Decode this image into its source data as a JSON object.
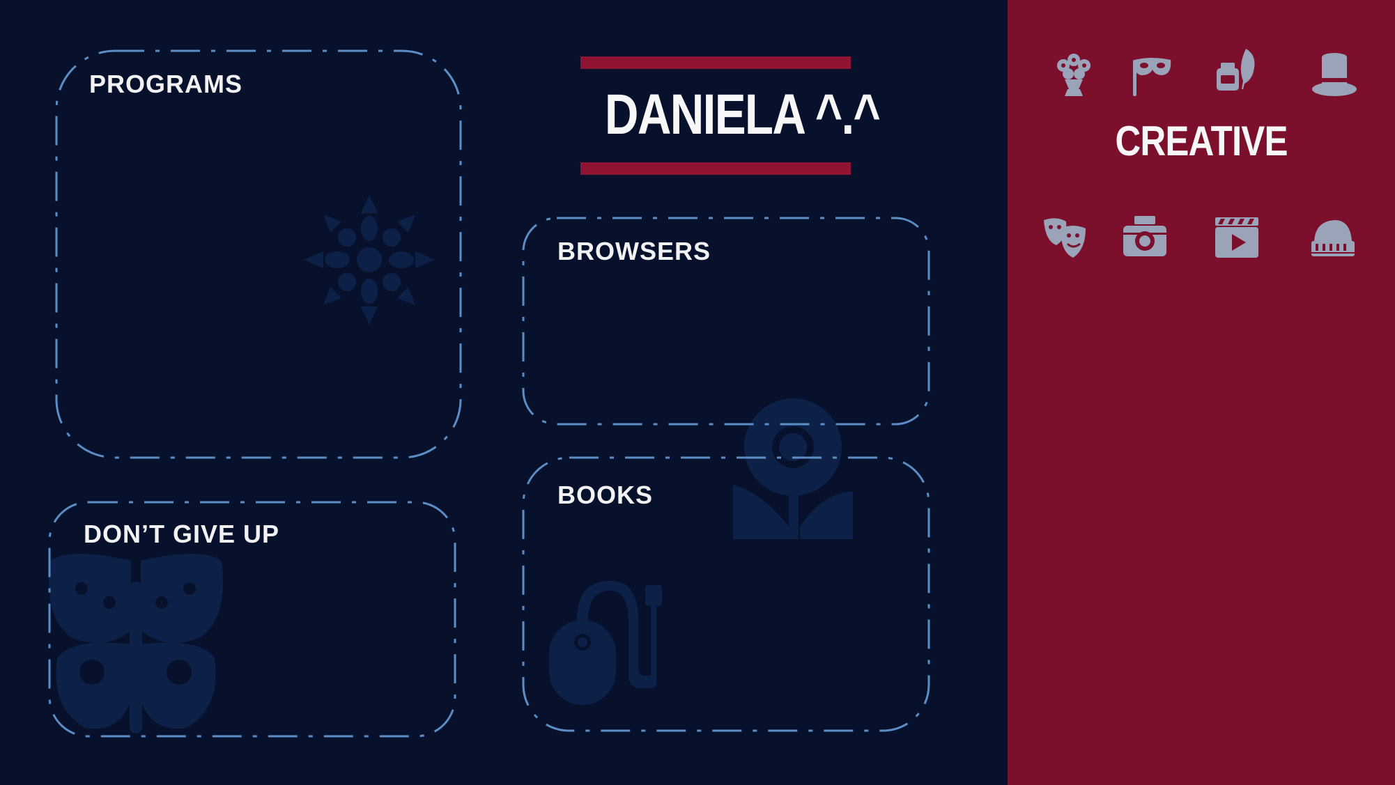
{
  "title": "DANIELA ^.^",
  "panels": {
    "programs": "PROGRAMS",
    "browsers": "BROWSERS",
    "books": "BOOKS",
    "dont_give_up": "DON’T GIVE UP"
  },
  "sidebar": {
    "title": "CREATIVE",
    "icons": [
      "flower-bouquet-icon",
      "carnival-mask-icon",
      "ink-quill-icon",
      "top-hat-icon",
      "theater-masks-icon",
      "camera-icon",
      "video-player-icon",
      "piano-icon"
    ]
  },
  "background_icons": [
    "snowflake-icon",
    "sunflower-icon",
    "butterfly-icon",
    "computer-mouse-icon"
  ],
  "colors": {
    "background": "#07112b",
    "sidebar": "#7b0f2c",
    "accent_bar": "#8e1432",
    "dashed_border": "#5b8ec7",
    "icon_gray": "#9aa3b8",
    "text": "#f2f2f2"
  }
}
